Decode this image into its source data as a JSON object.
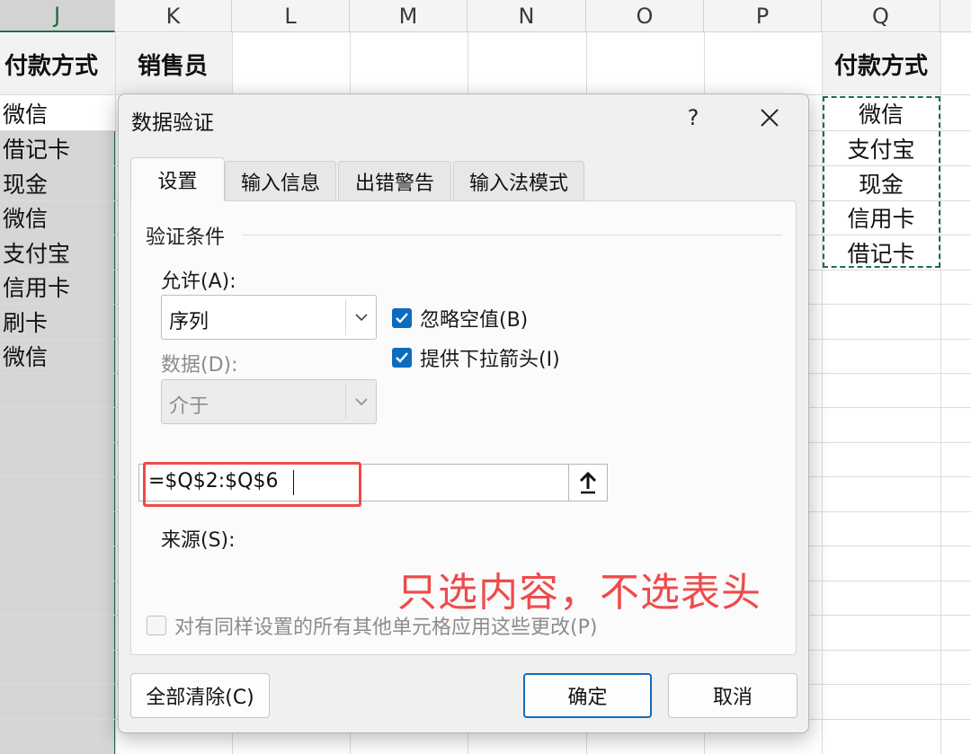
{
  "sheet": {
    "columns": [
      "J",
      "K",
      "L",
      "M",
      "N",
      "O",
      "P",
      "Q"
    ],
    "header_j": "付款方式",
    "header_k": "销售员",
    "header_q": "付款方式",
    "col_j_values": [
      "微信",
      "借记卡",
      "现金",
      "微信",
      "支付宝",
      "信用卡",
      "刷卡",
      "微信"
    ],
    "col_q_values": [
      "微信",
      "支付宝",
      "现金",
      "信用卡",
      "借记卡"
    ]
  },
  "dialog": {
    "title": "数据验证",
    "help": "?",
    "close": "✕",
    "tabs": [
      "设置",
      "输入信息",
      "出错警告",
      "输入法模式"
    ],
    "group_label": "验证条件",
    "allow_label": "允许(A):",
    "allow_value": "序列",
    "data_label": "数据(D):",
    "data_value": "介于",
    "ignore_blank": "忽略空值(B)",
    "dropdown_arrow": "提供下拉箭头(I)",
    "source_label": "来源(S):",
    "source_value": "=$Q$2:$Q$6",
    "apply_all": "对有同样设置的所有其他单元格应用这些更改(P)",
    "clear_all": "全部清除(C)",
    "ok": "确定",
    "cancel": "取消"
  },
  "annotation": "只选内容，不选表头",
  "colors": {
    "accent": "#0f6cbd",
    "annotation": "#ef4b4b",
    "selection_border": "#1e7145"
  },
  "icons": [
    "close-icon",
    "help-icon",
    "chevron-down-icon",
    "check-icon",
    "collapse-dialog-icon"
  ]
}
